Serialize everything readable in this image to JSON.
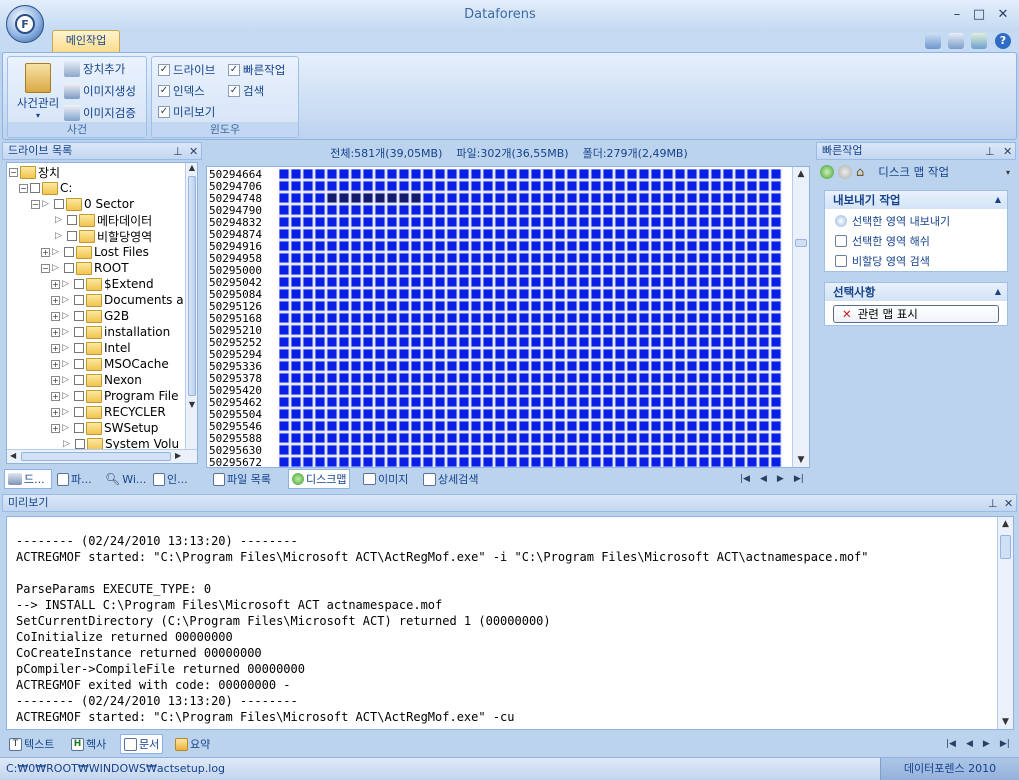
{
  "window": {
    "title": "Dataforens",
    "controls": [
      "–",
      "□",
      "✕"
    ]
  },
  "ribbon": {
    "tab_label": "메인작업",
    "case_group": {
      "label": "사건",
      "big_button": "사건관리",
      "add_device": "장치추가",
      "create_image": "이미지생성",
      "verify_image": "이미지검증"
    },
    "window_group": {
      "label": "윈도우",
      "drive": "드라이브",
      "quick_task": "빠른작업",
      "index": "인덱스",
      "search": "검색",
      "preview": "미리보기"
    }
  },
  "drive_panel": {
    "title": "드라이브 목록",
    "tree": [
      "장치",
      "C:",
      "0 Sector",
      "메타데이터",
      "비할당영역",
      "Lost Files",
      "ROOT",
      "$Extend",
      "Documents a",
      "G2B",
      "installation",
      "Intel",
      "MSOCache",
      "Nexon",
      "Program File",
      "RECYCLER",
      "SWSetup",
      "System Volu"
    ],
    "tabs": [
      "드...",
      "파...",
      "Wi...",
      "인..."
    ]
  },
  "map": {
    "stats": {
      "total": "전체:581개(39,05MB)",
      "files": "파일:302개(36,55MB)",
      "folders": "폴더:279개(2,49MB)"
    },
    "addresses": [
      "50294664",
      "50294706",
      "50294748",
      "50294790",
      "50294832",
      "50294874",
      "50294916",
      "50294958",
      "50295000",
      "50295042",
      "50295084",
      "50295126",
      "50295168",
      "50295210",
      "50295252",
      "50295294",
      "50295336",
      "50295378",
      "50295420",
      "50295462",
      "50295504",
      "50295546",
      "50295588",
      "50295630",
      "50295672"
    ],
    "tabs": [
      "파일 목록",
      "디스크맵",
      "이미지",
      "상세검색"
    ]
  },
  "quick_panel": {
    "title": "빠른작업",
    "toolbar_label": "디스크 맵 작업",
    "export_section": {
      "title": "내보내기 작업",
      "items": [
        "선택한 영역 내보내기",
        "선택한 영역 해쉬",
        "비할당 영역 검색"
      ]
    },
    "select_section": {
      "title": "선택사항",
      "button": "관련 맵 표시"
    }
  },
  "preview": {
    "title": "미리보기",
    "lines": [
      "-------- (02/24/2010 13:13:20) --------",
      "ACTREGMOF started: \"C:\\Program Files\\Microsoft ACT\\ActRegMof.exe\" -i \"C:\\Program Files\\Microsoft ACT\\actnamespace.mof\"",
      "",
      "ParseParams EXECUTE_TYPE: 0",
      "--> INSTALL C:\\Program Files\\Microsoft ACT actnamespace.mof",
      "SetCurrentDirectory (C:\\Program Files\\Microsoft ACT) returned 1 (00000000)",
      "CoInitialize returned 00000000",
      "CoCreateInstance returned 00000000",
      "pCompiler->CompileFile returned 00000000",
      "ACTREGMOF exited with code: 00000000 -",
      "-------- (02/24/2010 13:13:20) --------",
      "ACTREGMOF started: \"C:\\Program Files\\Microsoft ACT\\ActRegMof.exe\" -cu"
    ],
    "tabs": [
      "텍스트",
      "헥사",
      "문서",
      "요약"
    ]
  },
  "status": {
    "path": "C:₩0₩ROOT₩WINDOWS₩actsetup.log",
    "app_name": "데이터포렌스 2010"
  },
  "colors": {
    "block": "#0a1fe6",
    "block_selected": "#141a6e",
    "block_border": "#c9d2ff"
  }
}
